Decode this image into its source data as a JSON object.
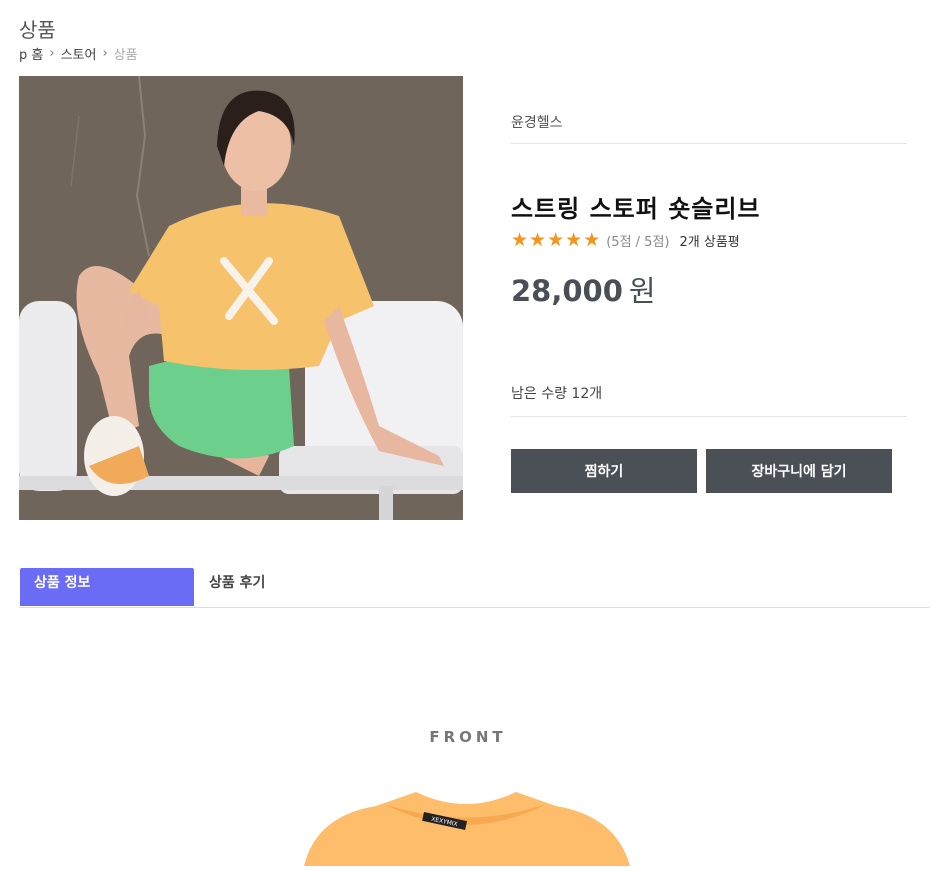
{
  "page": {
    "title": "상품",
    "breadcrumb": [
      "p 홈",
      "스토어",
      "상품"
    ]
  },
  "product": {
    "brand": "윤경헬스",
    "name": "스트링 스토퍼 숏슬리브",
    "rating_stars": 5,
    "rating_text": "(5점 / 5점)",
    "review_count": "2개 상품평",
    "price": "28,000",
    "price_unit": "원",
    "stock": "남은 수량 12개",
    "star_color": "#f29621"
  },
  "actions": {
    "wish_label": "찜하기",
    "cart_label": "장바구니에 담기"
  },
  "tabs": [
    {
      "label": "상품 정보",
      "active": true
    },
    {
      "label": "상품 후기",
      "active": false
    }
  ],
  "detail": {
    "front_label": "FRONT",
    "shirt_print": "XEXYMIX"
  },
  "colors": {
    "accent": "#6a6cf6",
    "button": "#4b5057"
  }
}
